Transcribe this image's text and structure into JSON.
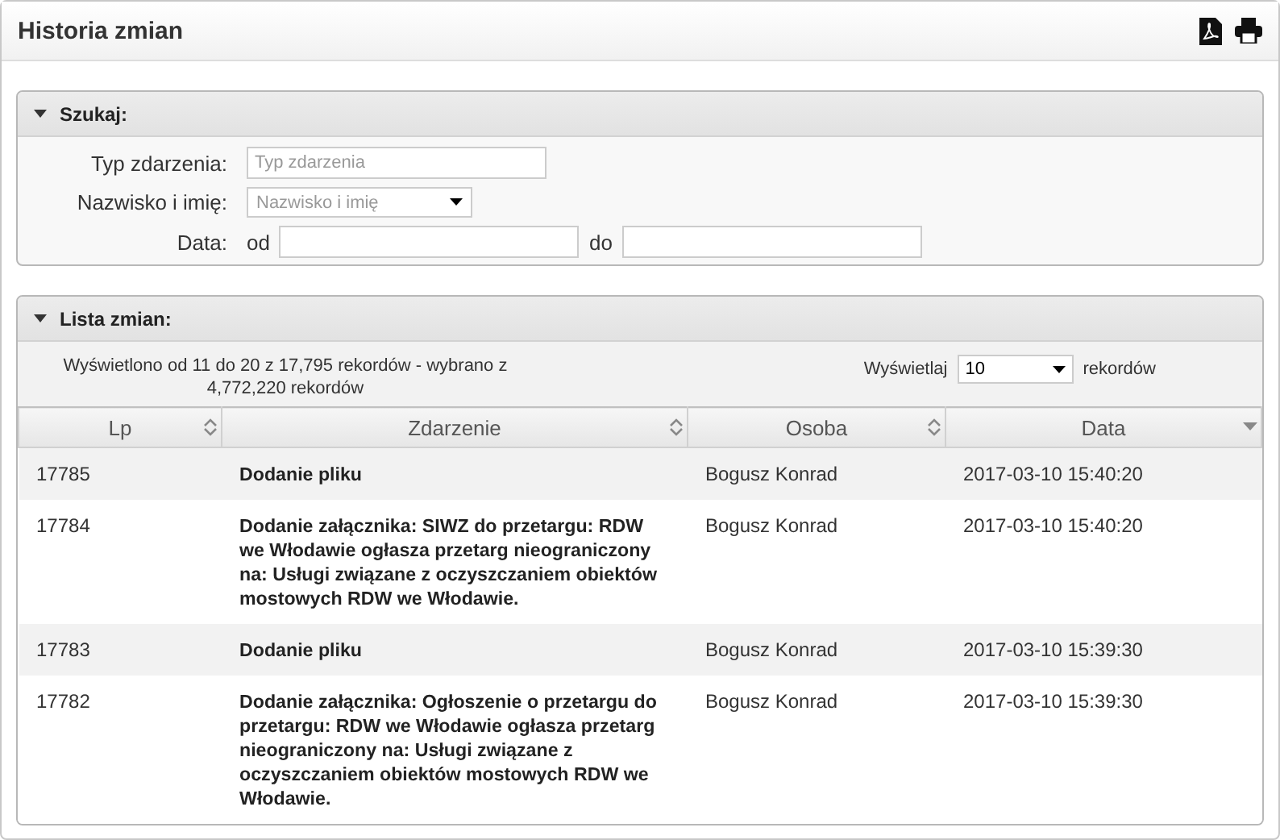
{
  "window": {
    "title": "Historia zmian"
  },
  "search": {
    "title": "Szukaj:",
    "expanded": true,
    "fields": [
      {
        "kind": "text",
        "label": "Typ zdarzenia:",
        "placeholder": "Typ zdarzenia"
      },
      {
        "kind": "select",
        "label": "Nazwisko i imię:",
        "placeholder": "Nazwisko i imię"
      },
      {
        "kind": "range",
        "label": "Data:",
        "from_label": "od",
        "to_label": "do"
      }
    ]
  },
  "list": {
    "title": "Lista zmian:",
    "expanded": true,
    "info": "Wyświetlono od 11 do 20 z 17,795 rekordów - wybrano z 4,772,220 rekordów",
    "page_size_label": "Wyświetlaj",
    "page_size": "10",
    "page_size_suffix": "rekordów",
    "columns": [
      {
        "label": "Lp",
        "sorted": false
      },
      {
        "label": "Zdarzenie",
        "sorted": false
      },
      {
        "label": "Osoba",
        "sorted": false
      },
      {
        "label": "Data",
        "sorted": true
      }
    ],
    "rows": [
      {
        "lp": "17785",
        "event": "Dodanie pliku",
        "person": "Bogusz Konrad",
        "date": "2017-03-10 15:40:20"
      },
      {
        "lp": "17784",
        "event": "Dodanie załącznika: SIWZ do przetargu: RDW we Włodawie ogłasza przetarg nieograniczony na: Usługi związane z oczyszczaniem obiektów mostowych RDW we Włodawie.",
        "person": "Bogusz Konrad",
        "date": "2017-03-10 15:40:20"
      },
      {
        "lp": "17783",
        "event": "Dodanie pliku",
        "person": "Bogusz Konrad",
        "date": "2017-03-10 15:39:30"
      },
      {
        "lp": "17782",
        "event": "Dodanie załącznika: Ogłoszenie o przetargu do przetargu: RDW we Włodawie ogłasza przetarg nieograniczony na: Usługi związane z oczyszczaniem obiektów mostowych RDW we Włodawie.",
        "person": "Bogusz Konrad",
        "date": "2017-03-10 15:39:30"
      }
    ]
  }
}
